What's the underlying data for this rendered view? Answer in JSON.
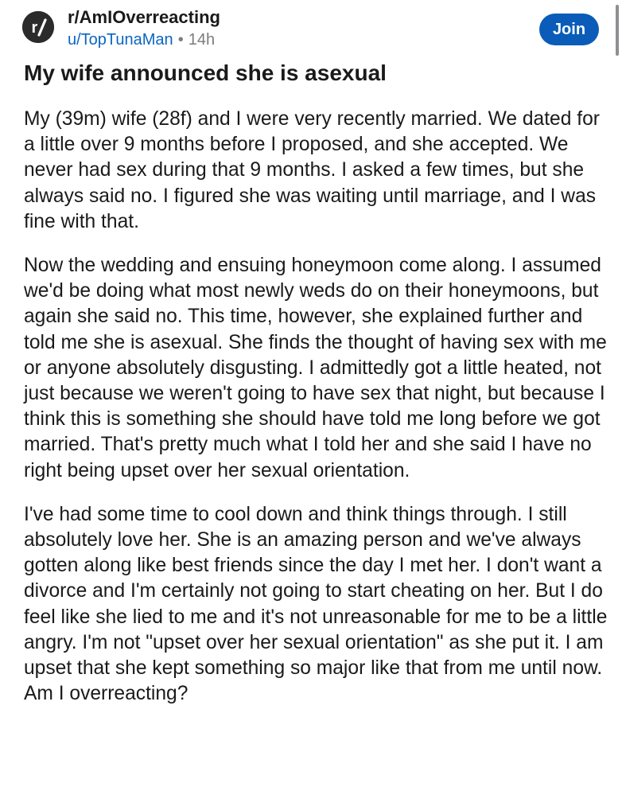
{
  "post": {
    "subreddit": "r/AmIOverreacting",
    "author": "u/TopTunaMan",
    "separator": "•",
    "age": "14h",
    "join_label": "Join",
    "title": "My wife announced she is asexual",
    "paragraphs": [
      "My (39m) wife (28f) and I were very recently married. We dated for a little over 9 months before I proposed, and she accepted. We never had sex during that 9 months. I asked a few times, but she always said no. I figured she was waiting until marriage, and I was fine with that.",
      "Now the wedding and ensuing honeymoon come along. I assumed we'd be doing what most newly weds do on their honeymoons, but again she said no. This time, however, she explained further and told me she is asexual. She finds the thought of having sex with me or anyone absolutely disgusting. I admittedly got a little heated, not just because we weren't going to have sex that night, but because I think this is something she should have told me long before we got married. That's pretty much what I told her and she said I have no right being upset over her sexual orientation.",
      "I've had some time to cool down and think things through. I still absolutely love her. She is an amazing person and we've always gotten along like best friends since the day I met her. I don't want a divorce and I'm certainly not going to start cheating on her. But I do feel like she lied to me and it's not unreasonable for me to be a little angry. I'm not \"upset over her sexual orientation\" as she put it. I am upset that she kept something so major like that from me until now. Am I overreacting?"
    ]
  },
  "icons": {
    "subreddit_avatar": "reddit-r-slash-icon"
  },
  "colors": {
    "join_button": "#0a5cb8",
    "author_link": "#0a66c2",
    "muted": "#7c7c7c",
    "text": "#1a1a1b"
  }
}
